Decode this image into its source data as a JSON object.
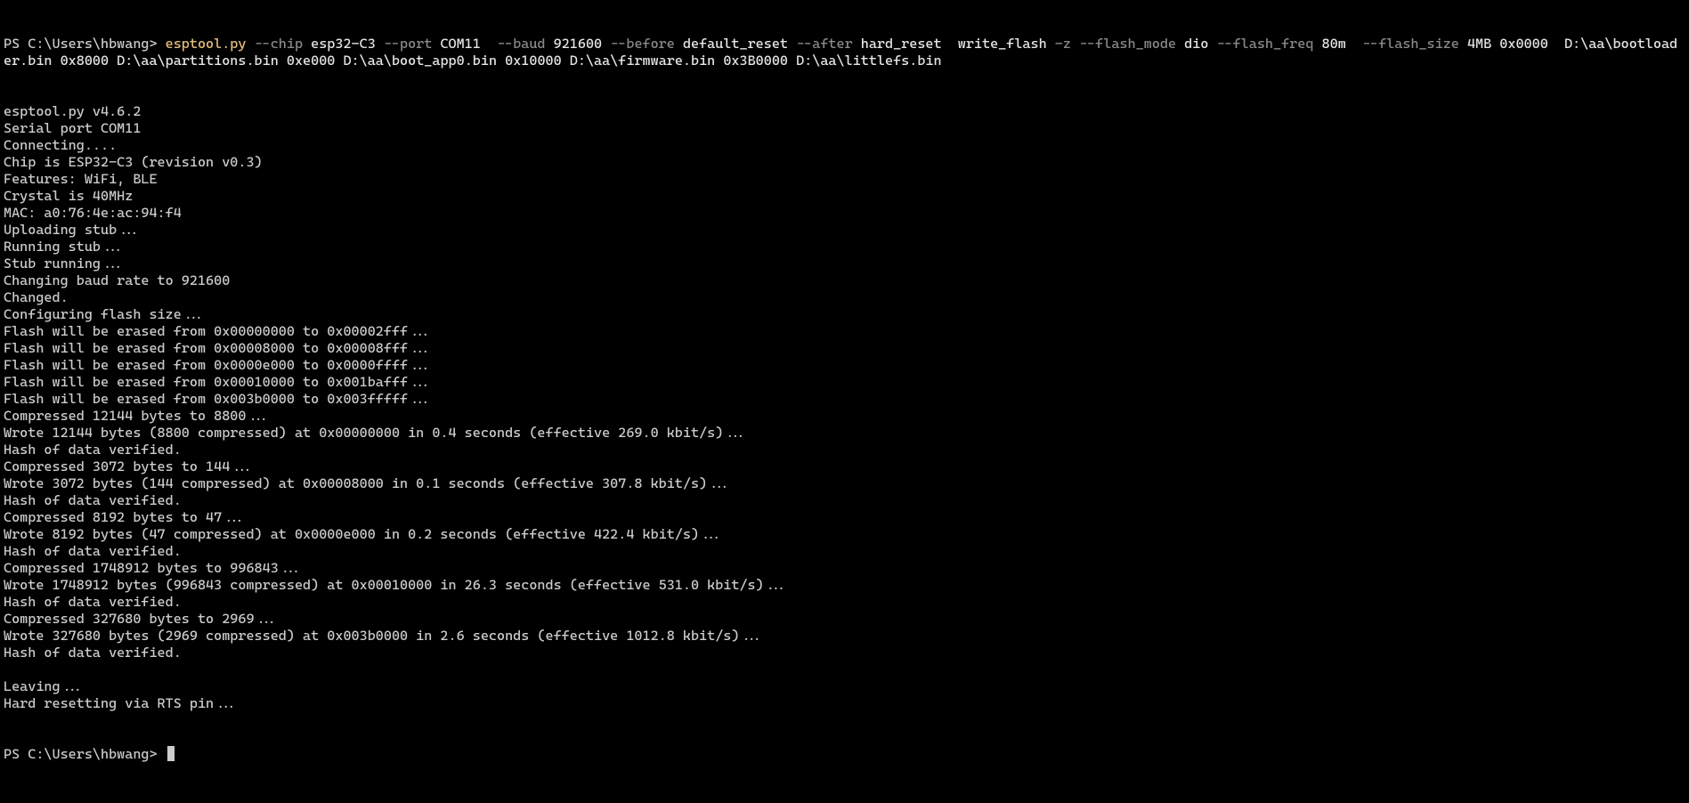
{
  "prompt1": {
    "prefix": "PS C:\\Users\\hbwang> ",
    "segments": [
      {
        "t": "esptool.py",
        "c": "cmd-yellow"
      },
      {
        "t": " --chip ",
        "c": "cmd-gray"
      },
      {
        "t": "esp32-C3",
        "c": "cmd-white"
      },
      {
        "t": " --port ",
        "c": "cmd-gray"
      },
      {
        "t": "COM11",
        "c": "cmd-white"
      },
      {
        "t": "  --baud ",
        "c": "cmd-gray"
      },
      {
        "t": "921600",
        "c": "cmd-white"
      },
      {
        "t": " --before ",
        "c": "cmd-gray"
      },
      {
        "t": "default_reset",
        "c": "cmd-white"
      },
      {
        "t": " --after ",
        "c": "cmd-gray"
      },
      {
        "t": "hard_reset",
        "c": "cmd-white"
      },
      {
        "t": "  write_flash",
        "c": "cmd-white"
      },
      {
        "t": " -z --flash_mode ",
        "c": "cmd-gray"
      },
      {
        "t": "dio",
        "c": "cmd-white"
      },
      {
        "t": " --flash_freq ",
        "c": "cmd-gray"
      },
      {
        "t": "80m",
        "c": "cmd-white"
      },
      {
        "t": "  --flash_size ",
        "c": "cmd-gray"
      },
      {
        "t": "4MB 0x0000",
        "c": "cmd-white"
      },
      {
        "t": "  D:\\aa\\bootloader.bin ",
        "c": "cmd-white"
      },
      {
        "t": "0x8000",
        "c": "cmd-white"
      },
      {
        "t": " D:\\aa\\partitions.bin ",
        "c": "cmd-white"
      },
      {
        "t": "0xe000",
        "c": "cmd-white"
      },
      {
        "t": " D:\\aa\\boot_app0.bin ",
        "c": "cmd-white"
      },
      {
        "t": "0x10000",
        "c": "cmd-white"
      },
      {
        "t": " D:\\aa\\firmware.bin ",
        "c": "cmd-white"
      },
      {
        "t": "0x3B0000",
        "c": "cmd-white"
      },
      {
        "t": " D:\\aa\\littlefs.bin",
        "c": "cmd-white"
      }
    ]
  },
  "outputLines": [
    "esptool.py v4.6.2",
    "Serial port COM11",
    "Connecting....",
    "Chip is ESP32-C3 (revision v0.3)",
    "Features: WiFi, BLE",
    "Crystal is 40MHz",
    "MAC: a0:76:4e:ac:94:f4",
    "Uploading stub...",
    "Running stub...",
    "Stub running...",
    "Changing baud rate to 921600",
    "Changed.",
    "Configuring flash size...",
    "Flash will be erased from 0x00000000 to 0x00002fff...",
    "Flash will be erased from 0x00008000 to 0x00008fff...",
    "Flash will be erased from 0x0000e000 to 0x0000ffff...",
    "Flash will be erased from 0x00010000 to 0x001bafff...",
    "Flash will be erased from 0x003b0000 to 0x003fffff...",
    "Compressed 12144 bytes to 8800...",
    "Wrote 12144 bytes (8800 compressed) at 0x00000000 in 0.4 seconds (effective 269.0 kbit/s)...",
    "Hash of data verified.",
    "Compressed 3072 bytes to 144...",
    "Wrote 3072 bytes (144 compressed) at 0x00008000 in 0.1 seconds (effective 307.8 kbit/s)...",
    "Hash of data verified.",
    "Compressed 8192 bytes to 47...",
    "Wrote 8192 bytes (47 compressed) at 0x0000e000 in 0.2 seconds (effective 422.4 kbit/s)...",
    "Hash of data verified.",
    "Compressed 1748912 bytes to 996843...",
    "Wrote 1748912 bytes (996843 compressed) at 0x00010000 in 26.3 seconds (effective 531.0 kbit/s)...",
    "Hash of data verified.",
    "Compressed 327680 bytes to 2969...",
    "Wrote 327680 bytes (2969 compressed) at 0x003b0000 in 2.6 seconds (effective 1012.8 kbit/s)...",
    "Hash of data verified.",
    "",
    "Leaving...",
    "Hard resetting via RTS pin..."
  ],
  "prompt2": {
    "prefix": "PS C:\\Users\\hbwang> "
  }
}
